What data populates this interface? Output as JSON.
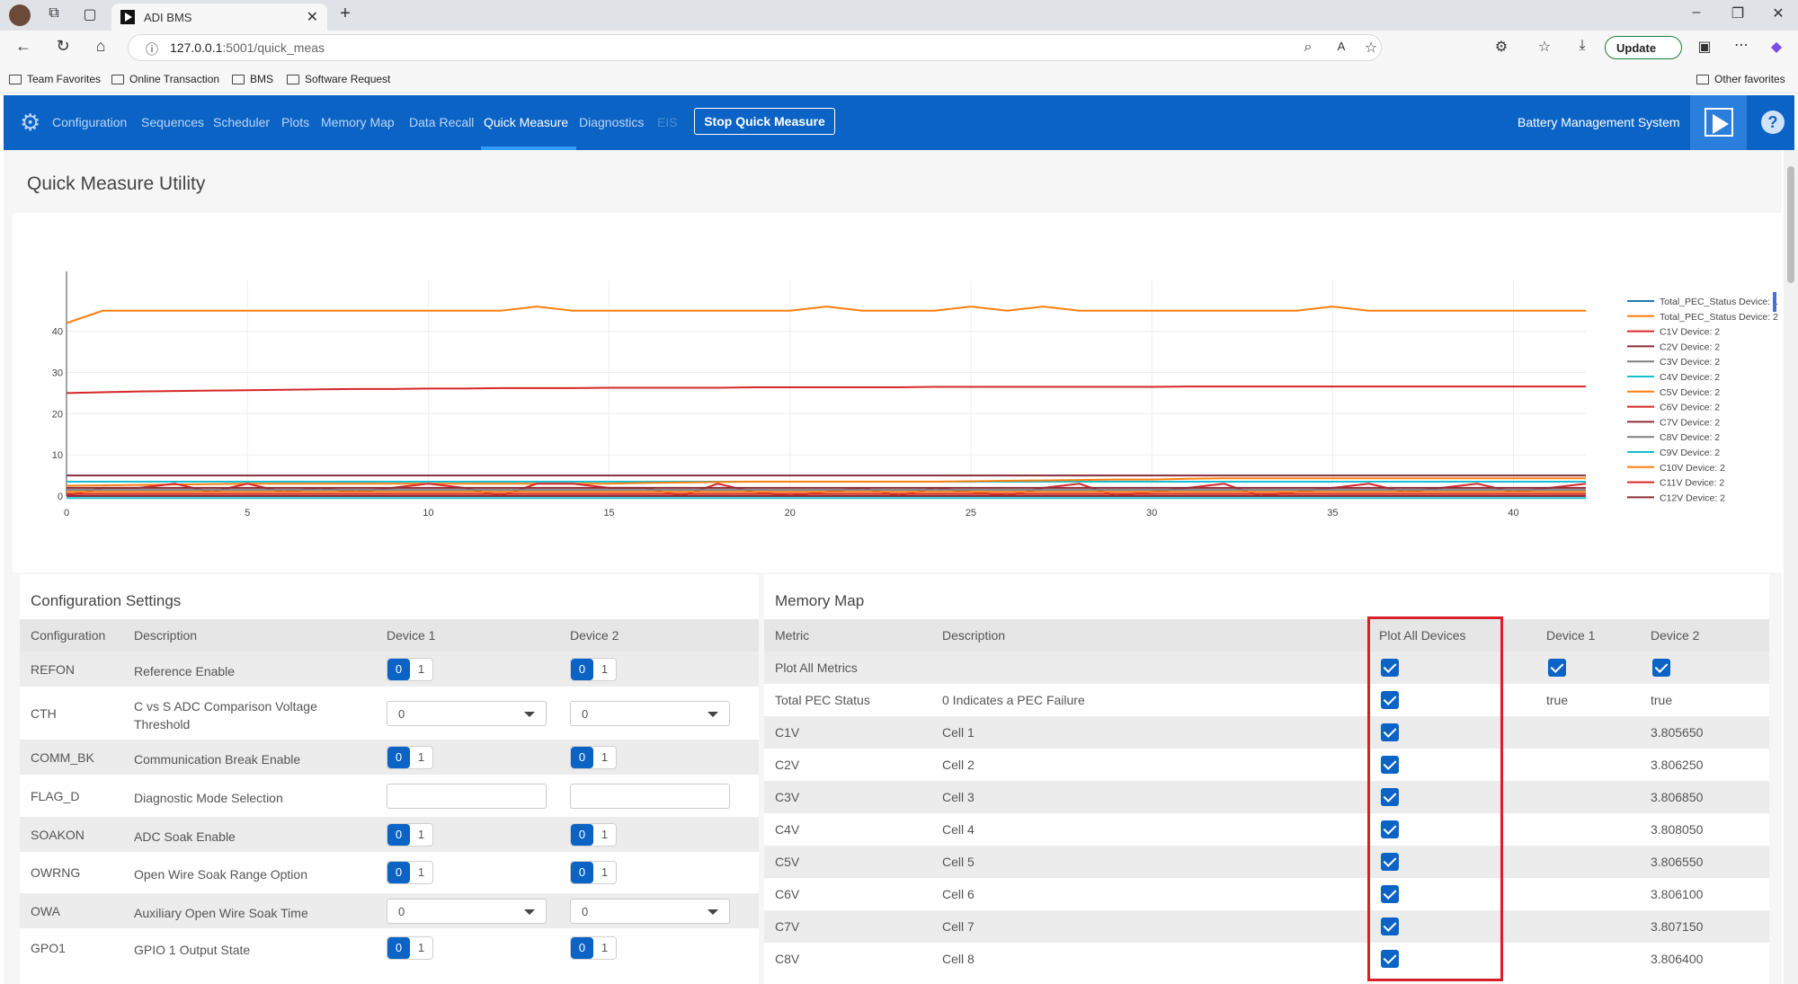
{
  "browser": {
    "tab_title": "ADI BMS",
    "url_host": "127.0.0.1",
    "url_path": ":5001/quick_meas",
    "update_label": "Update",
    "bookmarks": [
      "Team Favorites",
      "Online Transaction",
      "BMS",
      "Software Request"
    ],
    "other_favorites": "Other favorites"
  },
  "nav": {
    "items": [
      "Configuration",
      "Sequences",
      "Scheduler",
      "Plots",
      "Memory Map",
      "Data Recall",
      "Quick Measure",
      "Diagnostics",
      "EIS"
    ],
    "active": "Quick Measure",
    "stop_button": "Stop Quick Measure",
    "app_title": "Battery Management System"
  },
  "page_title": "Quick Measure Utility",
  "chart_data": {
    "type": "line",
    "xlim": [
      0,
      42
    ],
    "ylim": [
      0,
      48
    ],
    "x_ticks": [
      "0",
      "5",
      "10",
      "15",
      "20",
      "25",
      "30",
      "35",
      "40"
    ],
    "y_ticks": [
      "0",
      "10",
      "20",
      "30",
      "40"
    ],
    "legend_position": "right",
    "series": [
      {
        "name": "Total_PEC_Status Device: 1",
        "color": "#1f77b4",
        "values": [
          0,
          0,
          0,
          0,
          0,
          0,
          0,
          0,
          0,
          0,
          0,
          0,
          0,
          0,
          0,
          0,
          0,
          0,
          0,
          0,
          0,
          0,
          0,
          0,
          0,
          0,
          0,
          0,
          0,
          0,
          0,
          0,
          0,
          0,
          0,
          0,
          0,
          0,
          0,
          0,
          0,
          0,
          0
        ]
      },
      {
        "name": "Total_PEC_Status Device: 2",
        "color": "#ff7f0e",
        "values": [
          42,
          45,
          45,
          45,
          45,
          45,
          45,
          45,
          45,
          45,
          45,
          45,
          45,
          46,
          45,
          45,
          45,
          45,
          45,
          45,
          45,
          46,
          45,
          45,
          45,
          46,
          45,
          46,
          45,
          45,
          45,
          45,
          45,
          45,
          45,
          46,
          45,
          45,
          45,
          45,
          45,
          45,
          45
        ]
      },
      {
        "name": "C1V Device: 2",
        "color": "#d62728",
        "values": [
          25,
          25.2,
          25.4,
          25.5,
          25.6,
          25.7,
          25.8,
          25.9,
          26,
          26,
          26.1,
          26.1,
          26.2,
          26.2,
          26.2,
          26.3,
          26.3,
          26.3,
          26.3,
          26.4,
          26.4,
          26.4,
          26.4,
          26.4,
          26.5,
          26.5,
          26.5,
          26.5,
          26.5,
          26.5,
          26.5,
          26.6,
          26.6,
          26.6,
          26.6,
          26.6,
          26.6,
          26.6,
          26.6,
          26.6,
          26.6,
          26.6,
          26.6
        ]
      },
      {
        "name": "C2V Device: 2",
        "color": "#8c2d3a",
        "values": [
          5,
          5,
          5,
          5,
          5,
          5,
          5,
          5,
          5,
          5,
          5,
          5,
          5,
          5,
          5,
          5,
          5,
          5,
          5,
          5,
          5,
          5,
          5,
          5,
          5,
          5,
          5,
          5,
          5,
          5,
          5,
          5,
          5,
          5,
          5,
          5,
          5,
          5,
          5,
          5,
          5,
          5,
          5
        ]
      },
      {
        "name": "C3V Device: 2",
        "color": "#7f7f7f",
        "values": [
          1,
          1,
          1,
          1,
          1,
          1,
          1,
          1,
          1,
          1,
          1,
          1,
          1,
          1,
          1,
          1,
          1,
          1,
          1,
          1,
          1,
          1,
          1,
          1,
          1,
          1,
          1,
          1,
          1,
          1,
          1,
          1,
          1,
          1,
          1,
          1,
          1,
          1,
          1,
          1,
          1,
          1,
          1
        ]
      },
      {
        "name": "C4V Device: 2",
        "color": "#17becf",
        "values": [
          3.5,
          3.5,
          3.5,
          3.5,
          3.5,
          3.5,
          3.5,
          3.5,
          3.5,
          3.5,
          3.5,
          3.5,
          3.5,
          3.5,
          3.5,
          3.5,
          3.5,
          3.5,
          3.5,
          3.5,
          3.5,
          3.5,
          3.5,
          3.5,
          3.5,
          3.5,
          3.5,
          3.5,
          3.5,
          3.5,
          3.5,
          3.5,
          3.5,
          3.5,
          3.5,
          3.5,
          3.5,
          3.5,
          3.5,
          3.5,
          3.5,
          3.5,
          3.5
        ]
      },
      {
        "name": "C5V Device: 2",
        "color": "#ff7f0e",
        "values": [
          2.5,
          2.6,
          2.7,
          2.8,
          2.9,
          3,
          3,
          3,
          3,
          3,
          3,
          3,
          3,
          3,
          3,
          3,
          3.2,
          3.3,
          3.4,
          3.5,
          3.5,
          3.5,
          3.5,
          3.5,
          3.5,
          3.6,
          3.7,
          3.8,
          3.9,
          4,
          4,
          4.2,
          4.3,
          4.3,
          4.3,
          4.3,
          4.3,
          4.3,
          4.3,
          4.3,
          4.3,
          4.3,
          4.3
        ]
      },
      {
        "name": "C6V Device: 2",
        "color": "#d62728",
        "values": [
          0,
          2,
          2,
          3,
          1,
          3,
          1,
          2,
          1,
          2,
          3,
          2,
          0,
          3,
          3,
          2,
          2,
          0,
          3,
          1,
          0,
          1,
          2,
          0,
          2,
          1,
          0,
          2,
          3,
          0,
          1,
          2,
          3,
          0,
          1,
          2,
          3,
          1,
          2,
          3,
          1,
          2,
          3
        ]
      },
      {
        "name": "C7V Device: 2",
        "color": "#8c2d3a",
        "values": [
          2,
          2,
          2,
          2,
          2,
          2,
          2,
          2,
          2,
          2,
          2,
          2,
          2,
          2,
          2,
          2,
          2,
          2,
          2,
          2,
          2,
          2,
          2,
          2,
          2,
          2,
          2,
          2,
          2,
          2,
          2,
          2,
          2,
          2,
          2,
          2,
          2,
          2,
          2,
          2,
          2,
          2,
          2
        ]
      },
      {
        "name": "C8V Device: 2",
        "color": "#7f7f7f",
        "values": [
          1.5,
          1.5,
          1.5,
          1.5,
          1.5,
          1.5,
          1.5,
          1.5,
          1.5,
          1.5,
          1.5,
          1.5,
          1.5,
          1.5,
          1.5,
          1.5,
          1.5,
          1.5,
          1.5,
          1.5,
          1.5,
          1.5,
          1.5,
          1.5,
          1.5,
          1.5,
          1.5,
          1.5,
          1.5,
          1.5,
          1.5,
          1.5,
          1.5,
          1.5,
          1.5,
          1.5,
          1.5,
          1.5,
          1.5,
          1.5,
          1.5,
          1.5,
          1.5
        ]
      },
      {
        "name": "C9V Device: 2",
        "color": "#17becf",
        "values": [
          -0.5,
          -0.5,
          -0.5,
          -0.5,
          -0.5,
          -0.5,
          -0.5,
          -0.5,
          -0.5,
          -0.5,
          -0.5,
          -0.5,
          -0.5,
          -0.5,
          -0.5,
          -0.5,
          -0.5,
          -0.5,
          -0.5,
          -0.5,
          -0.5,
          -0.5,
          -0.5,
          -0.5,
          -0.5,
          -0.5,
          -0.5,
          -0.5,
          -0.5,
          -0.5,
          -0.5,
          -0.5,
          -0.5,
          -0.5,
          -0.5,
          -0.5,
          -0.5,
          -0.5,
          -0.5,
          -0.5,
          -0.5,
          -0.5,
          -0.5
        ]
      },
      {
        "name": "C10V Device: 2",
        "color": "#ff7f0e",
        "values": [
          1,
          1,
          1,
          1,
          1,
          1,
          1,
          1,
          1,
          1,
          1,
          1,
          1,
          1,
          1,
          1,
          1,
          1,
          1,
          1,
          1,
          1,
          1,
          1,
          1,
          1,
          1,
          1,
          1,
          1,
          1,
          1,
          1,
          1,
          1,
          1,
          1,
          1,
          1,
          1,
          1,
          1,
          1
        ]
      },
      {
        "name": "C11V Device: 2",
        "color": "#d62728",
        "values": [
          0.5,
          0.5,
          0.5,
          0.5,
          0.5,
          0.5,
          0.5,
          0.5,
          0.5,
          0.5,
          0.5,
          0.5,
          0.5,
          0.5,
          0.5,
          0.5,
          0.5,
          0.5,
          0.5,
          0.5,
          0.5,
          0.5,
          0.5,
          0.5,
          0.5,
          0.5,
          0.5,
          0.5,
          0.5,
          0.5,
          0.5,
          0.5,
          0.5,
          0.5,
          0.5,
          0.5,
          0.5,
          0.5,
          0.5,
          0.5,
          0.5,
          0.5,
          0.5
        ]
      },
      {
        "name": "C12V Device: 2",
        "color": "#8c2d3a",
        "values": [
          0,
          0,
          0,
          0,
          0,
          0,
          0,
          0,
          0,
          0,
          0,
          0,
          0,
          0,
          0,
          0,
          0,
          0,
          0,
          0,
          0,
          0,
          0,
          0,
          0,
          0,
          0,
          0,
          0,
          0,
          0,
          0,
          0,
          0,
          0,
          0,
          0,
          0,
          0,
          0,
          0,
          0,
          0
        ]
      }
    ]
  },
  "config": {
    "title": "Configuration Settings",
    "headers": [
      "Configuration",
      "Description",
      "Device 1",
      "Device 2"
    ],
    "rows": [
      {
        "name": "REFON",
        "desc": "Reference Enable",
        "kind": "toggle",
        "d1": "0",
        "d2": "0"
      },
      {
        "name": "CTH",
        "desc": "C vs S ADC Comparison Voltage Threshold",
        "kind": "select",
        "d1": "0",
        "d2": "0"
      },
      {
        "name": "COMM_BK",
        "desc": "Communication Break Enable",
        "kind": "toggle",
        "d1": "0",
        "d2": "0"
      },
      {
        "name": "FLAG_D",
        "desc": "Diagnostic Mode Selection",
        "kind": "text",
        "d1": "",
        "d2": ""
      },
      {
        "name": "SOAKON",
        "desc": "ADC Soak Enable",
        "kind": "toggle",
        "d1": "0",
        "d2": "0"
      },
      {
        "name": "OWRNG",
        "desc": "Open Wire Soak Range Option",
        "kind": "toggle",
        "d1": "0",
        "d2": "0"
      },
      {
        "name": "OWA",
        "desc": "Auxiliary Open Wire Soak Time",
        "kind": "select",
        "d1": "0",
        "d2": "0"
      },
      {
        "name": "GPO1",
        "desc": "GPIO 1 Output State",
        "kind": "toggle",
        "d1": "0",
        "d2": "0"
      }
    ]
  },
  "memmap": {
    "title": "Memory Map",
    "headers": [
      "Metric",
      "Description",
      "Plot All Devices",
      "Device 1",
      "Device 2"
    ],
    "rows": [
      {
        "metric": "Plot All Metrics",
        "desc": "",
        "d1": "",
        "d2": "",
        "d1cb": true,
        "d2cb": true
      },
      {
        "metric": "Total PEC Status",
        "desc": "0 Indicates a PEC Failure",
        "d1": "true",
        "d2": "true"
      },
      {
        "metric": "C1V",
        "desc": "Cell 1",
        "d1": "",
        "d2": "3.805650"
      },
      {
        "metric": "C2V",
        "desc": "Cell 2",
        "d1": "",
        "d2": "3.806250"
      },
      {
        "metric": "C3V",
        "desc": "Cell 3",
        "d1": "",
        "d2": "3.806850"
      },
      {
        "metric": "C4V",
        "desc": "Cell 4",
        "d1": "",
        "d2": "3.808050"
      },
      {
        "metric": "C5V",
        "desc": "Cell 5",
        "d1": "",
        "d2": "3.806550"
      },
      {
        "metric": "C6V",
        "desc": "Cell 6",
        "d1": "",
        "d2": "3.806100"
      },
      {
        "metric": "C7V",
        "desc": "Cell 7",
        "d1": "",
        "d2": "3.807150"
      },
      {
        "metric": "C8V",
        "desc": "Cell 8",
        "d1": "",
        "d2": "3.806400"
      }
    ]
  }
}
